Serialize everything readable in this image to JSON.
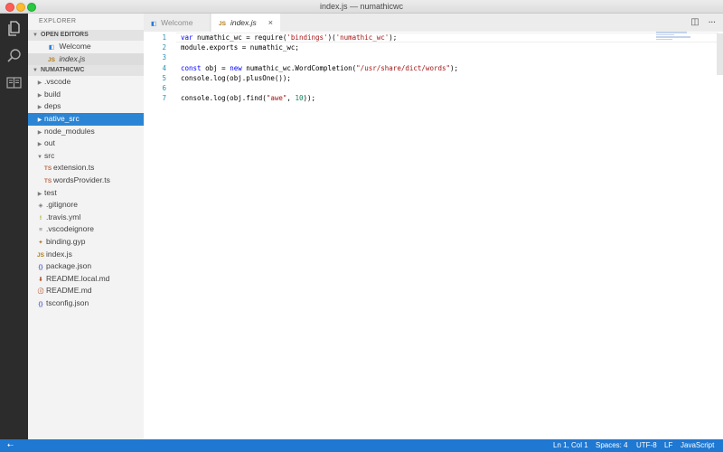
{
  "window": {
    "title": "index.js — numathicwc"
  },
  "activity_bar": {
    "icons": [
      "files-icon",
      "search-icon",
      "book-icon"
    ]
  },
  "sidebar": {
    "title": "EXPLORER",
    "open_editors": {
      "label": "OPEN EDITORS",
      "items": [
        {
          "label": "Welcome",
          "icon": "welcome-icon",
          "glyph": "◧"
        },
        {
          "label": "index.js",
          "icon": "js-file-icon",
          "glyph": "JS"
        }
      ]
    },
    "project": {
      "label": "NUMATHICWC",
      "items": [
        {
          "label": ".vscode",
          "type": "folder"
        },
        {
          "label": "build",
          "type": "folder"
        },
        {
          "label": "deps",
          "type": "folder"
        },
        {
          "label": "native_src",
          "type": "folder"
        },
        {
          "label": "node_modules",
          "type": "folder"
        },
        {
          "label": "out",
          "type": "folder"
        },
        {
          "label": "src",
          "type": "folder"
        },
        {
          "label": "extension.ts",
          "type": "ts",
          "glyph": "TS"
        },
        {
          "label": "wordsProvider.ts",
          "type": "ts",
          "glyph": "TS"
        },
        {
          "label": "test",
          "type": "folder"
        },
        {
          "label": ".gitignore",
          "type": "file",
          "glyph": "◈"
        },
        {
          "label": ".travis.yml",
          "type": "file",
          "glyph": "!"
        },
        {
          "label": ".vscodeignore",
          "type": "file",
          "glyph": "≡"
        },
        {
          "label": "binding.gyp",
          "type": "file",
          "glyph": "✦"
        },
        {
          "label": "index.js",
          "type": "js",
          "glyph": "JS"
        },
        {
          "label": "package.json",
          "type": "json",
          "glyph": "{}"
        },
        {
          "label": "README.local.md",
          "type": "md",
          "glyph": "⬇"
        },
        {
          "label": "README.md",
          "type": "md",
          "glyph": "ⓘ"
        },
        {
          "label": "tsconfig.json",
          "type": "json",
          "glyph": "{}"
        }
      ]
    }
  },
  "tabs": [
    {
      "label": "Welcome",
      "glyph": "◧"
    },
    {
      "label": "index.js",
      "glyph": "JS",
      "close": "×"
    }
  ],
  "toolbar": {
    "split_glyph": "◫",
    "more_glyph": "···"
  },
  "editor": {
    "lines": [
      {
        "n": "1",
        "parts": [
          [
            "kw",
            "var"
          ],
          [
            "p",
            " numathic_wc = require("
          ],
          [
            "str",
            "'bindings'"
          ],
          [
            "p",
            ")("
          ],
          [
            "str",
            "'numathic_wc'"
          ],
          [
            "p",
            ");"
          ]
        ]
      },
      {
        "n": "2",
        "parts": [
          [
            "p",
            "module.exports = numathic_wc;"
          ]
        ]
      },
      {
        "n": "3",
        "parts": []
      },
      {
        "n": "4",
        "parts": [
          [
            "kw",
            "const"
          ],
          [
            "p",
            " obj = "
          ],
          [
            "kw",
            "new"
          ],
          [
            "p",
            " numathic_wc.WordCompletion("
          ],
          [
            "str",
            "\"/usr/share/dict/words\""
          ],
          [
            "p",
            ");"
          ]
        ]
      },
      {
        "n": "5",
        "parts": [
          [
            "p",
            "console.log(obj.plusOne());"
          ]
        ]
      },
      {
        "n": "6",
        "parts": []
      },
      {
        "n": "7",
        "parts": [
          [
            "p",
            "console.log(obj.find("
          ],
          [
            "str",
            "\"awe\""
          ],
          [
            "p",
            ", "
          ],
          [
            "num",
            "10"
          ],
          [
            "p",
            "));"
          ]
        ]
      }
    ]
  },
  "statusbar": {
    "left_glyph": "⇠",
    "position": "Ln 1, Col 1",
    "indent": "Spaces: 4",
    "encoding": "UTF-8",
    "eol": "LF",
    "language": "JavaScript"
  },
  "colors": {
    "accent": "#1f78d1",
    "selection": "#2b85d4"
  }
}
